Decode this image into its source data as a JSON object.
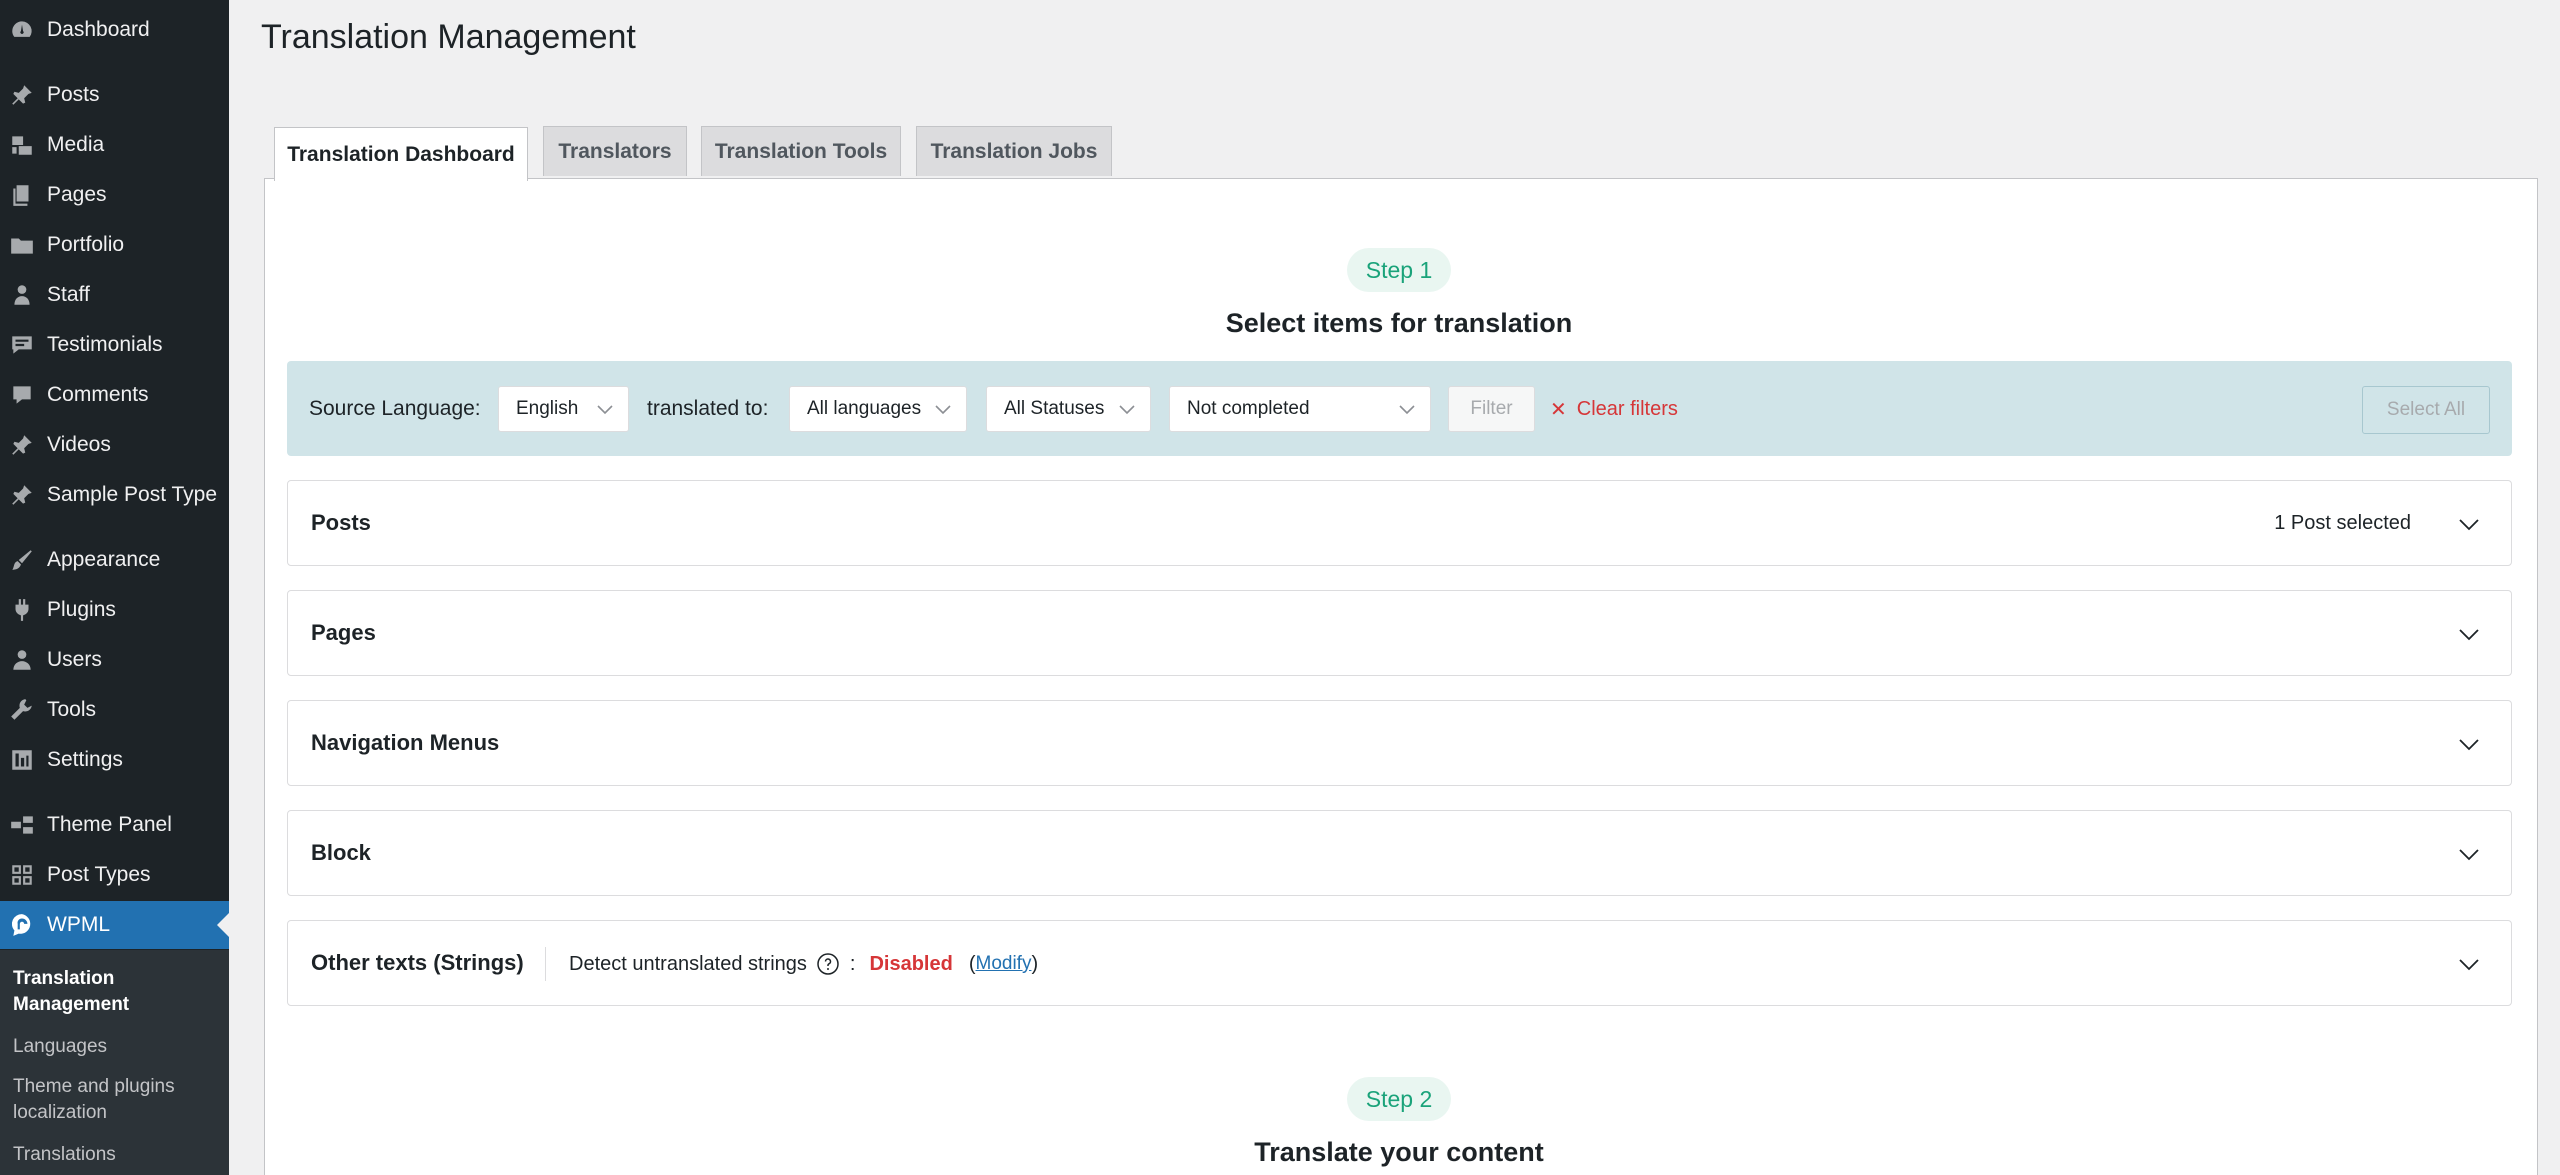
{
  "sidebar": {
    "items": [
      {
        "label": "Dashboard",
        "icon": "dashboard-icon"
      },
      {
        "label": "Posts",
        "icon": "pin-icon"
      },
      {
        "label": "Media",
        "icon": "media-icon"
      },
      {
        "label": "Pages",
        "icon": "pages-icon"
      },
      {
        "label": "Portfolio",
        "icon": "folder-icon"
      },
      {
        "label": "Staff",
        "icon": "staff-icon"
      },
      {
        "label": "Testimonials",
        "icon": "testimonials-icon"
      },
      {
        "label": "Comments",
        "icon": "comments-icon"
      },
      {
        "label": "Videos",
        "icon": "pin-icon"
      },
      {
        "label": "Sample Post Type",
        "icon": "pin-icon"
      },
      {
        "label": "Appearance",
        "icon": "appearance-icon"
      },
      {
        "label": "Plugins",
        "icon": "plugins-icon"
      },
      {
        "label": "Users",
        "icon": "users-icon"
      },
      {
        "label": "Tools",
        "icon": "tools-icon"
      },
      {
        "label": "Settings",
        "icon": "settings-icon"
      },
      {
        "label": "Theme Panel",
        "icon": "theme-panel-icon"
      },
      {
        "label": "Post Types",
        "icon": "grid-icon"
      },
      {
        "label": "WPML",
        "icon": "wpml-icon"
      }
    ],
    "submenu": [
      {
        "label": "Translation Management"
      },
      {
        "label": "Languages"
      },
      {
        "label": "Theme and plugins localization"
      },
      {
        "label": "Translations"
      }
    ]
  },
  "page": {
    "title": "Translation Management"
  },
  "tabs": [
    {
      "label": "Translation Dashboard"
    },
    {
      "label": "Translators"
    },
    {
      "label": "Translation Tools"
    },
    {
      "label": "Translation Jobs"
    }
  ],
  "step1": {
    "badge": "Step 1",
    "title": "Select items for translation"
  },
  "filters": {
    "source_language_label": "Source Language:",
    "source_language_value": "English",
    "translated_to_label": "translated to:",
    "target_languages_value": "All languages",
    "statuses_value": "All Statuses",
    "completion_value": "Not completed",
    "filter_button": "Filter",
    "clear_filters": "Clear filters",
    "select_all": "Select All"
  },
  "sections": [
    {
      "title": "Posts",
      "meta": "1 Post selected"
    },
    {
      "title": "Pages",
      "meta": ""
    },
    {
      "title": "Navigation Menus",
      "meta": ""
    },
    {
      "title": "Block",
      "meta": ""
    }
  ],
  "strings_section": {
    "title": "Other texts (Strings)",
    "detect_label": "Detect untranslated strings",
    "colon": ":",
    "status": "Disabled",
    "open_paren": "(",
    "modify_link": "Modify",
    "close_paren": ")"
  },
  "step2": {
    "badge": "Step 2",
    "title": "Translate your content"
  },
  "colors": {
    "sidebar_bg": "#1d2327",
    "active_menu": "#2271b1",
    "step_green": "#1aa37a",
    "filter_bar_bg": "#d0e4e8",
    "danger": "#d63638"
  }
}
